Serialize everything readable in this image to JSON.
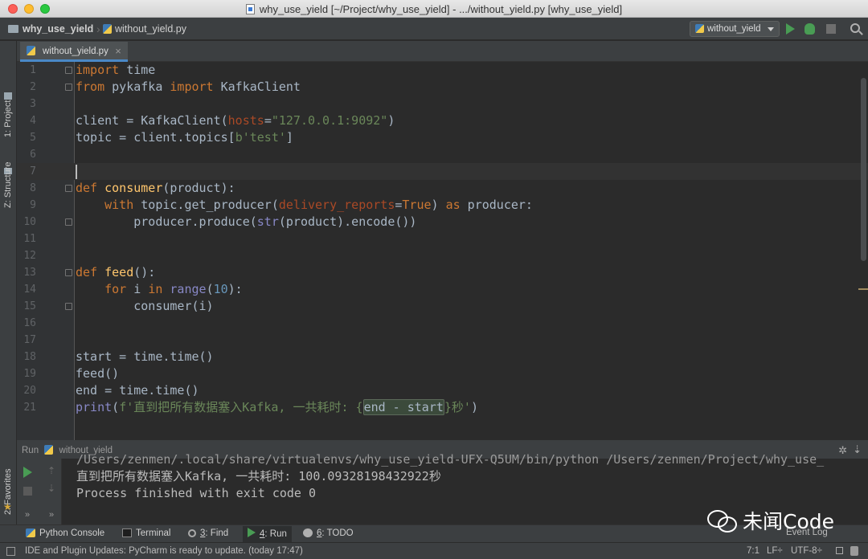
{
  "window": {
    "title": "why_use_yield [~/Project/why_use_yield] - .../without_yield.py [why_use_yield]"
  },
  "navbar": {
    "project": "why_use_yield",
    "file": "without_yield.py",
    "run_config": "without_yield"
  },
  "toolstrip": {
    "project": "1: Project",
    "structure": "Z: Structure",
    "favorites": "2: Favorites"
  },
  "editor": {
    "tab_label": "without_yield.py",
    "tab_close": "×",
    "line_numbers": [
      "1",
      "2",
      "3",
      "4",
      "5",
      "6",
      "7",
      "8",
      "9",
      "10",
      "11",
      "12",
      "13",
      "14",
      "15",
      "16",
      "17",
      "18",
      "19",
      "20",
      "21"
    ],
    "code": {
      "l1_kw": "import",
      "l1_rest": " time",
      "l2_kw1": "from",
      "l2_mid": " pykafka ",
      "l2_kw2": "import",
      "l2_rest": " KafkaClient",
      "l4_a": "client = KafkaClient(",
      "l4_param": "hosts",
      "l4_eq": "=",
      "l4_str": "\"127.0.0.1:9092\"",
      "l4_end": ")",
      "l5_a": "topic = client.topics[",
      "l5_str": "b'test'",
      "l5_end": "]",
      "l8_kw": "def",
      "l8_fn": "consumer",
      "l8_rest": "(product):",
      "l9_kw": "with",
      "l9_a": " topic.get_producer(",
      "l9_param": "delivery_reports",
      "l9_eq": "=",
      "l9_kw2": "True",
      "l9_b": ") ",
      "l9_kw3": "as",
      "l9_c": " producer:",
      "l10_a": "producer.produce(",
      "l10_bi": "str",
      "l10_b": "(product).encode())",
      "l13_kw": "def",
      "l13_fn": "feed",
      "l13_rest": "():",
      "l14_kw": "for",
      "l14_a": " i ",
      "l14_kw2": "in",
      "l14_sp": " ",
      "l14_bi": "range",
      "l14_p1": "(",
      "l14_num": "10",
      "l14_p2": "):",
      "l15": "consumer(i)",
      "l18": "start = time.time()",
      "l19": "feed()",
      "l20": "end = time.time()",
      "l21_bi": "print",
      "l21_p": "(",
      "l21_str1": "f'直到把所有数据塞入Kafka, 一共耗时: {",
      "l21_expr": "end - start",
      "l21_str2": "}秒'",
      "l21_end": ")"
    }
  },
  "run_panel": {
    "label": "Run",
    "config": "without_yield",
    "gear": "✲",
    "pin": "⇣",
    "up": "⇡",
    "down": "⇣",
    "more": "»",
    "output_line1": "/Users/zenmen/.local/share/virtualenvs/why_use_yield-UFX-Q5UM/bin/python /Users/zenmen/Project/why_use_",
    "output_line2": "直到把所有数据塞入Kafka, 一共耗时: 100.09328198432922秒",
    "output_line3": "",
    "output_line4": "Process finished with exit code 0"
  },
  "bottom_tools": {
    "python_console": "Python Console",
    "terminal": "Terminal",
    "find_num": "3",
    "find_label": ": Find",
    "run_num": "4",
    "run_label": ": Run",
    "todo_num": "6",
    "todo_label": ": TODO",
    "event_log": "Event Log"
  },
  "status": {
    "message": "IDE and Plugin Updates: PyCharm is ready to update. (today 17:47)",
    "position": "7:1",
    "line_sep": "LF÷",
    "encoding": "UTF-8÷"
  },
  "watermark": {
    "text": "未闻Code"
  },
  "colors": {
    "background": "#2b2b2b",
    "keyword": "#cc7832",
    "string": "#6a8759",
    "number": "#6897bb",
    "function": "#ffc66d",
    "builtin": "#8888c6",
    "run_green": "#499c54"
  }
}
